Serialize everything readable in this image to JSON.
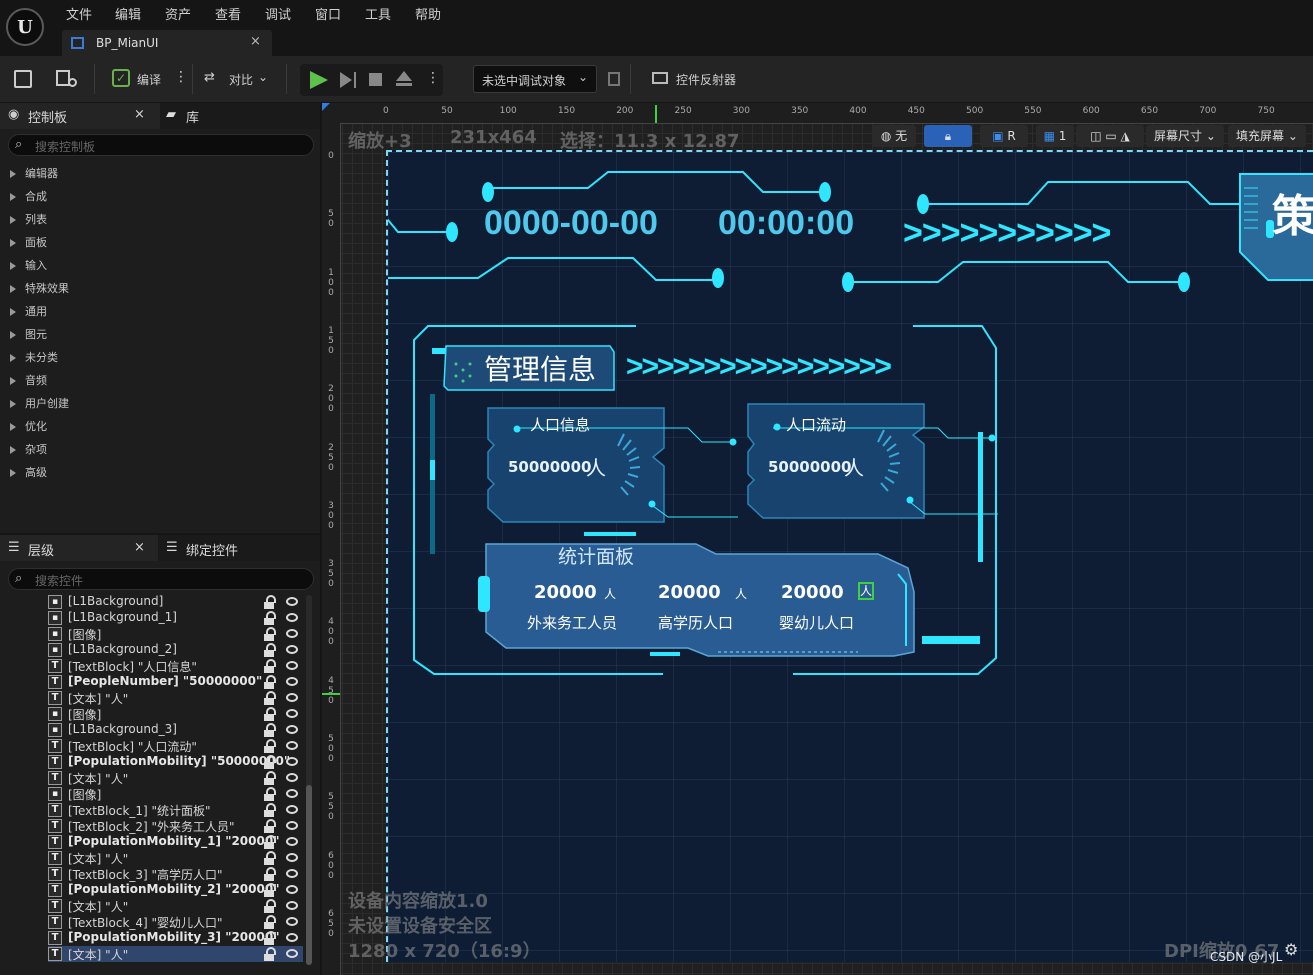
{
  "app": {
    "logo_glyph": "U"
  },
  "menu": {
    "items": [
      "文件",
      "编辑",
      "资产",
      "查看",
      "调试",
      "窗口",
      "工具",
      "帮助"
    ]
  },
  "tab": {
    "title": "BP_MianUI",
    "close": "×"
  },
  "toolbar": {
    "compile_label": "编译",
    "diff_label": "对比",
    "debug_select": "未选中调试对象",
    "widget_reflector": "控件反射器"
  },
  "palette": {
    "tab_label": "控制板",
    "library_label": "库",
    "close": "×",
    "search_placeholder": "搜索控制板",
    "categories": [
      "编辑器",
      "合成",
      "列表",
      "面板",
      "输入",
      "特殊效果",
      "通用",
      "图元",
      "未分类",
      "音频",
      "用户创建",
      "优化",
      "杂项",
      "高级"
    ]
  },
  "hierarchy": {
    "tab_label": "层级",
    "bind_label": "绑定控件",
    "close": "×",
    "search_placeholder": "搜索控件",
    "rows": [
      {
        "icon": "img",
        "text": "[L1Background]",
        "bold": false
      },
      {
        "icon": "img",
        "text": "[L1Background_1]",
        "bold": false
      },
      {
        "icon": "img",
        "text": "[图像]",
        "bold": false
      },
      {
        "icon": "img",
        "text": "[L1Background_2]",
        "bold": false
      },
      {
        "icon": "T",
        "text": "[TextBlock] \"人口信息\"",
        "bold": false
      },
      {
        "icon": "T",
        "text": "[PeopleNumber] \"50000000\"",
        "bold": true
      },
      {
        "icon": "T",
        "text": "[文本] \"人\"",
        "bold": false
      },
      {
        "icon": "img",
        "text": "[图像]",
        "bold": false
      },
      {
        "icon": "img",
        "text": "[L1Background_3]",
        "bold": false
      },
      {
        "icon": "T",
        "text": "[TextBlock] \"人口流动\"",
        "bold": false
      },
      {
        "icon": "T",
        "text": "[PopulationMobility] \"50000000\"",
        "bold": true
      },
      {
        "icon": "T",
        "text": "[文本] \"人\"",
        "bold": false
      },
      {
        "icon": "img",
        "text": "[图像]",
        "bold": false
      },
      {
        "icon": "T",
        "text": "[TextBlock_1] \"统计面板\"",
        "bold": false
      },
      {
        "icon": "T",
        "text": "[TextBlock_2] \"外来务工人员\"",
        "bold": false
      },
      {
        "icon": "T",
        "text": "[PopulationMobility_1] \"20000\"",
        "bold": true
      },
      {
        "icon": "T",
        "text": "[文本] \"人\"",
        "bold": false
      },
      {
        "icon": "T",
        "text": "[TextBlock_3] \"高学历人口\"",
        "bold": false
      },
      {
        "icon": "T",
        "text": "[PopulationMobility_2] \"20000\"",
        "bold": true
      },
      {
        "icon": "T",
        "text": "[文本] \"人\"",
        "bold": false
      },
      {
        "icon": "T",
        "text": "[TextBlock_4] \"婴幼儿人口\"",
        "bold": false
      },
      {
        "icon": "T",
        "text": "[PopulationMobility_3] \"20000\"",
        "bold": true
      },
      {
        "icon": "T",
        "text": "[文本] \"人\"",
        "bold": false
      }
    ],
    "selected_index": 22
  },
  "viewport": {
    "zoom_label": "缩放+3",
    "size_label": "231x464",
    "selection_label": "选择：11.3 x 12.87",
    "globe_label": "无",
    "r_label": "R",
    "grid_label": "1",
    "screen_size_label": "屏幕尺寸",
    "fill_screen_label": "填充屏幕",
    "ruler_top": [
      "0",
      "50",
      "100",
      "150",
      "200",
      "250",
      "300",
      "350",
      "400",
      "450",
      "500",
      "550",
      "600",
      "650",
      "700",
      "750"
    ],
    "ruler_left": [
      "0",
      "5 0",
      "1 0 0",
      "1 5 0",
      "2 0 0",
      "2 5 0",
      "3 0 0",
      "3 5 0",
      "4 0 0",
      "4 5 0",
      "5 0 0",
      "5 5 0",
      "6 0 0",
      "6 5 0"
    ],
    "device_scale": "设备内容缩放1.0",
    "safe_zone": "未设置设备安全区",
    "resolution": "1280 x 720（16:9）",
    "dpi": "DPI缩放0.67",
    "watermark": "CSDN @小JL"
  },
  "design": {
    "date": "0000-00-00",
    "time": "00:00:00",
    "arrows_top": ">>>>>>>>>>>",
    "panel_title": "管理信息",
    "panel_arrows": ">>>>>>>>>>>>>>>>>",
    "card1": {
      "title": "人口信息",
      "value": "50000000",
      "unit": "人"
    },
    "card2": {
      "title": "人口流动",
      "value": "50000000",
      "unit": "人"
    },
    "stats": {
      "title": "统计面板",
      "items": [
        {
          "value": "20000",
          "unit": "人",
          "label": "外来务工人员"
        },
        {
          "value": "20000",
          "unit": "人",
          "label": "高学历人口"
        },
        {
          "value": "20000",
          "unit": "人",
          "label": "婴幼儿人口"
        }
      ]
    },
    "side_glyph": "策",
    "colors": {
      "cyan": "#2ee6ff",
      "panel": "#1a4a7a",
      "bg": "#0e1d33"
    }
  }
}
